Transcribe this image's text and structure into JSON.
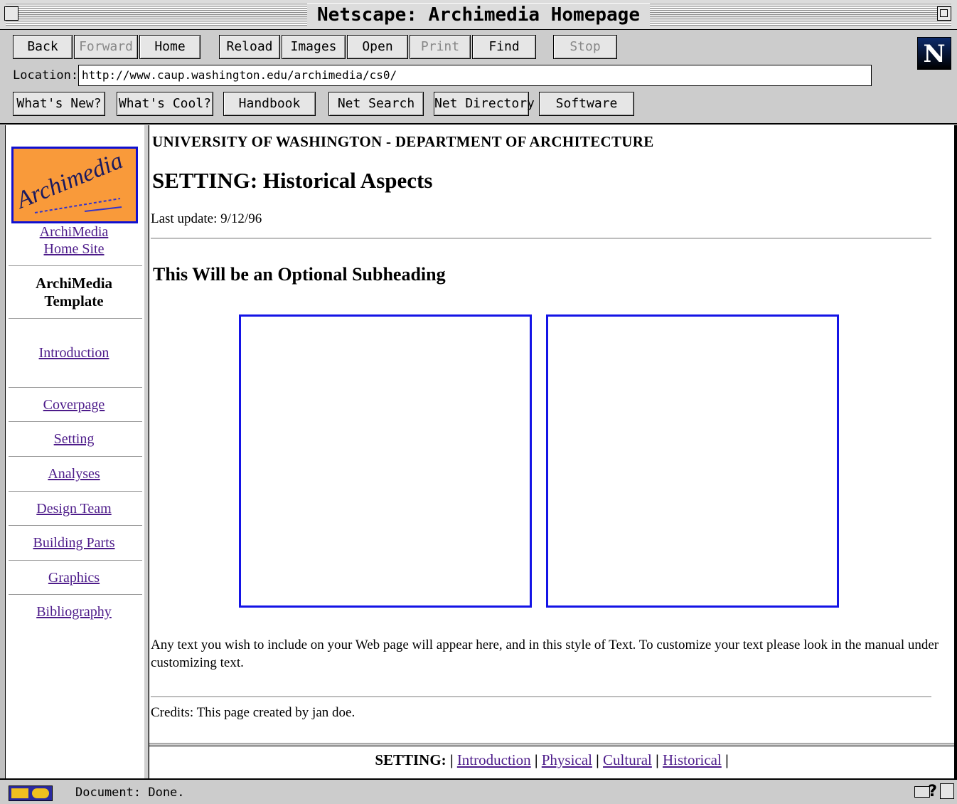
{
  "window": {
    "title": "Netscape: Archimedia Homepage"
  },
  "toolbar": {
    "back": "Back",
    "forward": "Forward",
    "home": "Home",
    "reload": "Reload",
    "images": "Images",
    "open": "Open",
    "print": "Print",
    "find": "Find",
    "stop": "Stop"
  },
  "location": {
    "label": "Location:",
    "url": "http://www.caup.washington.edu/archimedia/cs0/"
  },
  "directory": {
    "whats_new": "What's New?",
    "whats_cool": "What's Cool?",
    "handbook": "Handbook",
    "net_search": "Net Search",
    "net_directory": "Net Directory",
    "software": "Software"
  },
  "brand": {
    "logo_letter": "N",
    "site_logo_text": "Archimedia"
  },
  "sidebar": {
    "home_link_line1": "ArchiMedia",
    "home_link_line2": "Home Site",
    "current_line1": "ArchiMedia",
    "current_line2": "Template",
    "items": [
      "Introduction",
      "Coverpage",
      "Setting",
      "Analyses",
      "Design Team",
      "Building Parts",
      "Graphics",
      "Bibliography"
    ]
  },
  "main": {
    "department": "UNIVERSITY OF WASHINGTON - DEPARTMENT OF ARCHITECTURE",
    "title": "SETTING: Historical Aspects",
    "last_update": "Last update: 9/12/96",
    "subheading": "This Will be an Optional Subheading",
    "body_text": "Any text you wish to include on your Web page will appear here, and in this style of Text. To customize your text please look in the manual under customizing text.",
    "credits": "Credits: This page created by jan doe."
  },
  "footer_nav": {
    "label": "SETTING:",
    "separator": "|",
    "links": [
      "Introduction",
      "Physical",
      "Cultural",
      "Historical"
    ]
  },
  "status": {
    "text": "Document: Done."
  },
  "colors": {
    "link": "#4d1b8a",
    "image_border": "#1414e6",
    "logo_bg": "#f99a3a"
  }
}
